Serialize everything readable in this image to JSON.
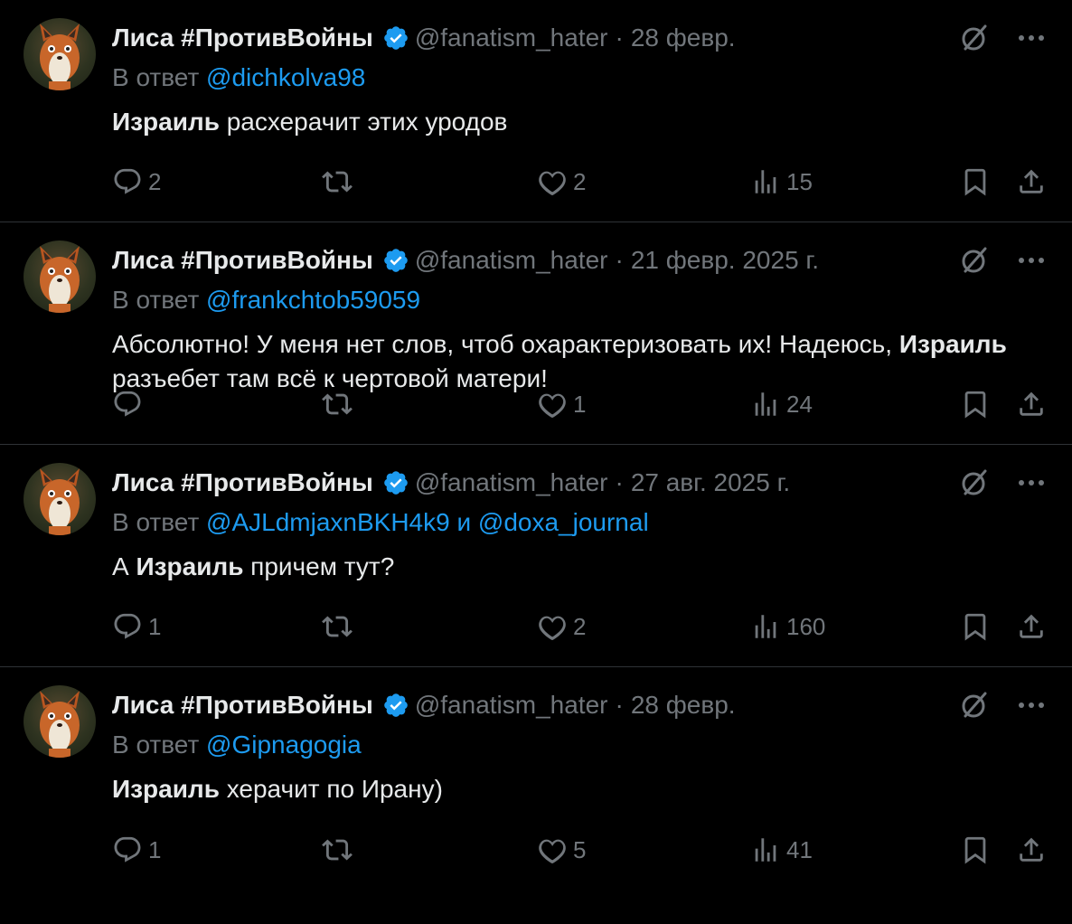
{
  "colors": {
    "background": "#000000",
    "primary_text": "#e7e9ea",
    "secondary_text": "#71767b",
    "link": "#1d9bf0",
    "divider": "#2f3336"
  },
  "tweets": [
    {
      "author": "Лиса #ПротивВойны",
      "handle": "@fanatism_hater",
      "separator": "·",
      "date": "28 февр.",
      "reply_prefix": "В ответ",
      "reply_to": "@dichkolva98",
      "text_bold": "Израиль",
      "text_rest": " расхерачит этих уродов",
      "replies": "2",
      "retweets": "",
      "likes": "2",
      "views": "15"
    },
    {
      "author": "Лиса #ПротивВойны",
      "handle": "@fanatism_hater",
      "separator": "·",
      "date": "21 февр. 2025 г.",
      "reply_prefix": "В ответ",
      "reply_to": "@frankchtob59059",
      "text_pre": "Абсолютно! У меня нет слов, чтоб охарактеризовать их! Надеюсь, ",
      "text_bold": "Израиль",
      "text_rest": " разъебет там всё к чертовой матери!",
      "replies": "",
      "retweets": "",
      "likes": "1",
      "views": "24"
    },
    {
      "author": "Лиса #ПротивВойны",
      "handle": "@fanatism_hater",
      "separator": "·",
      "date": "27 авг. 2025 г.",
      "reply_prefix": "В ответ",
      "reply_to": "@AJLdmjaxnBKH4k9",
      "reply_joiner": "и",
      "reply_to_2": "@doxa_journal",
      "text_pre": "А ",
      "text_bold": "Израиль",
      "text_rest": " причем тут?",
      "replies": "1",
      "retweets": "",
      "likes": "2",
      "views": "160"
    },
    {
      "author": "Лиса #ПротивВойны",
      "handle": "@fanatism_hater",
      "separator": "·",
      "date": "28 февр.",
      "reply_prefix": "В ответ",
      "reply_to": "@Gipnagogia",
      "text_bold": "Израиль",
      "text_rest": " херачит по Ирану)",
      "replies": "1",
      "retweets": "",
      "likes": "5",
      "views": "41"
    }
  ],
  "icons": {
    "verified": "verified-badge-icon",
    "grok": "grok-icon",
    "more": "more-dots-icon",
    "reply": "reply-bubble-icon",
    "retweet": "retweet-icon",
    "like": "heart-icon",
    "views": "views-bars-icon",
    "bookmark": "bookmark-icon",
    "share": "share-icon",
    "avatar": "fox-avatar"
  }
}
